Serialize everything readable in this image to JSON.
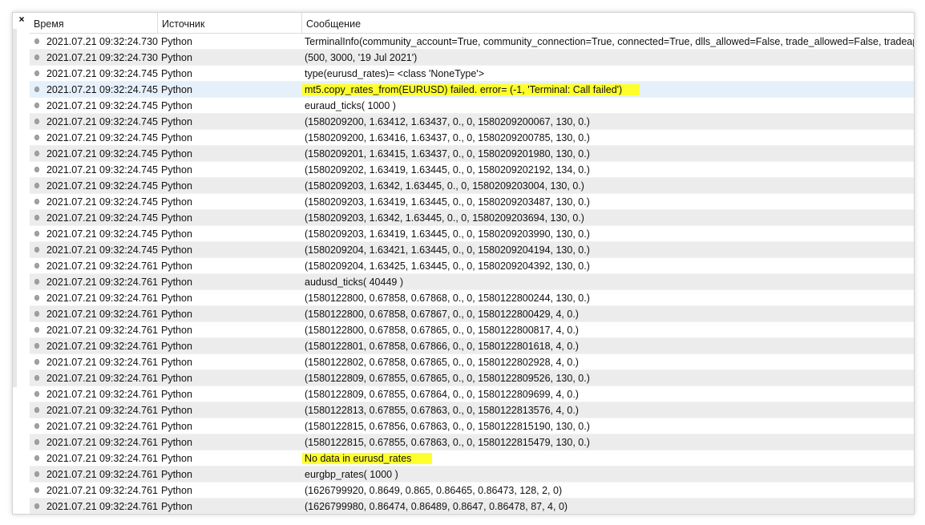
{
  "window": {
    "close_glyph": "×"
  },
  "columns": {
    "time": "Время",
    "source": "Источник",
    "message": "Сообщение"
  },
  "colors": {
    "highlight": "#ffff2e",
    "selected_row": "#e5f0fb",
    "alt_row": "#ececec"
  },
  "rows": [
    {
      "time": "2021.07.21 09:32:24.730",
      "source": "Python",
      "message": "TerminalInfo(community_account=True, community_connection=True, connected=True, dlls_allowed=False, trade_allowed=False, tradeapi_disa"
    },
    {
      "time": "2021.07.21 09:32:24.730",
      "source": "Python",
      "message": "(500, 3000, '19 Jul 2021')"
    },
    {
      "time": "2021.07.21 09:32:24.745",
      "source": "Python",
      "message": "type(eurusd_rates)= <class 'NoneType'>"
    },
    {
      "time": "2021.07.21 09:32:24.745",
      "source": "Python",
      "message": "mt5.copy_rates_from(EURUSD) failed. error= (-1, 'Terminal: Call failed')"
    },
    {
      "time": "2021.07.21 09:32:24.745",
      "source": "Python",
      "message": "euraud_ticks( 1000 )"
    },
    {
      "time": "2021.07.21 09:32:24.745",
      "source": "Python",
      "message": "(1580209200, 1.63412, 1.63437, 0., 0, 1580209200067, 130, 0.)"
    },
    {
      "time": "2021.07.21 09:32:24.745",
      "source": "Python",
      "message": "(1580209200, 1.63416, 1.63437, 0., 0, 1580209200785, 130, 0.)"
    },
    {
      "time": "2021.07.21 09:32:24.745",
      "source": "Python",
      "message": "(1580209201, 1.63415, 1.63437, 0., 0, 1580209201980, 130, 0.)"
    },
    {
      "time": "2021.07.21 09:32:24.745",
      "source": "Python",
      "message": "(1580209202, 1.63419, 1.63445, 0., 0, 1580209202192, 134, 0.)"
    },
    {
      "time": "2021.07.21 09:32:24.745",
      "source": "Python",
      "message": "(1580209203, 1.6342, 1.63445, 0., 0, 1580209203004, 130, 0.)"
    },
    {
      "time": "2021.07.21 09:32:24.745",
      "source": "Python",
      "message": "(1580209203, 1.63419, 1.63445, 0., 0, 1580209203487, 130, 0.)"
    },
    {
      "time": "2021.07.21 09:32:24.745",
      "source": "Python",
      "message": "(1580209203, 1.6342, 1.63445, 0., 0, 1580209203694, 130, 0.)"
    },
    {
      "time": "2021.07.21 09:32:24.745",
      "source": "Python",
      "message": "(1580209203, 1.63419, 1.63445, 0., 0, 1580209203990, 130, 0.)"
    },
    {
      "time": "2021.07.21 09:32:24.745",
      "source": "Python",
      "message": "(1580209204, 1.63421, 1.63445, 0., 0, 1580209204194, 130, 0.)"
    },
    {
      "time": "2021.07.21 09:32:24.761",
      "source": "Python",
      "message": "(1580209204, 1.63425, 1.63445, 0., 0, 1580209204392, 130, 0.)"
    },
    {
      "time": "2021.07.21 09:32:24.761",
      "source": "Python",
      "message": "audusd_ticks( 40449 )"
    },
    {
      "time": "2021.07.21 09:32:24.761",
      "source": "Python",
      "message": "(1580122800, 0.67858, 0.67868, 0., 0, 1580122800244, 130, 0.)"
    },
    {
      "time": "2021.07.21 09:32:24.761",
      "source": "Python",
      "message": "(1580122800, 0.67858, 0.67867, 0., 0, 1580122800429, 4, 0.)"
    },
    {
      "time": "2021.07.21 09:32:24.761",
      "source": "Python",
      "message": "(1580122800, 0.67858, 0.67865, 0., 0, 1580122800817, 4, 0.)"
    },
    {
      "time": "2021.07.21 09:32:24.761",
      "source": "Python",
      "message": "(1580122801, 0.67858, 0.67866, 0., 0, 1580122801618, 4, 0.)"
    },
    {
      "time": "2021.07.21 09:32:24.761",
      "source": "Python",
      "message": "(1580122802, 0.67858, 0.67865, 0., 0, 1580122802928, 4, 0.)"
    },
    {
      "time": "2021.07.21 09:32:24.761",
      "source": "Python",
      "message": "(1580122809, 0.67855, 0.67865, 0., 0, 1580122809526, 130, 0.)"
    },
    {
      "time": "2021.07.21 09:32:24.761",
      "source": "Python",
      "message": "(1580122809, 0.67855, 0.67864, 0., 0, 1580122809699, 4, 0.)"
    },
    {
      "time": "2021.07.21 09:32:24.761",
      "source": "Python",
      "message": "(1580122813, 0.67855, 0.67863, 0., 0, 1580122813576, 4, 0.)"
    },
    {
      "time": "2021.07.21 09:32:24.761",
      "source": "Python",
      "message": "(1580122815, 0.67856, 0.67863, 0., 0, 1580122815190, 130, 0.)"
    },
    {
      "time": "2021.07.21 09:32:24.761",
      "source": "Python",
      "message": "(1580122815, 0.67855, 0.67863, 0., 0, 1580122815479, 130, 0.)"
    },
    {
      "time": "2021.07.21 09:32:24.761",
      "source": "Python",
      "message": "No data in eurusd_rates"
    },
    {
      "time": "2021.07.21 09:32:24.761",
      "source": "Python",
      "message": "eurgbp_rates( 1000 )"
    },
    {
      "time": "2021.07.21 09:32:24.761",
      "source": "Python",
      "message": "(1626799920, 0.8649, 0.865, 0.86465, 0.86473, 128, 2, 0)"
    },
    {
      "time": "2021.07.21 09:32:24.761",
      "source": "Python",
      "message": "(1626799980, 0.86474, 0.86489, 0.8647, 0.86478, 87, 4, 0)"
    }
  ]
}
